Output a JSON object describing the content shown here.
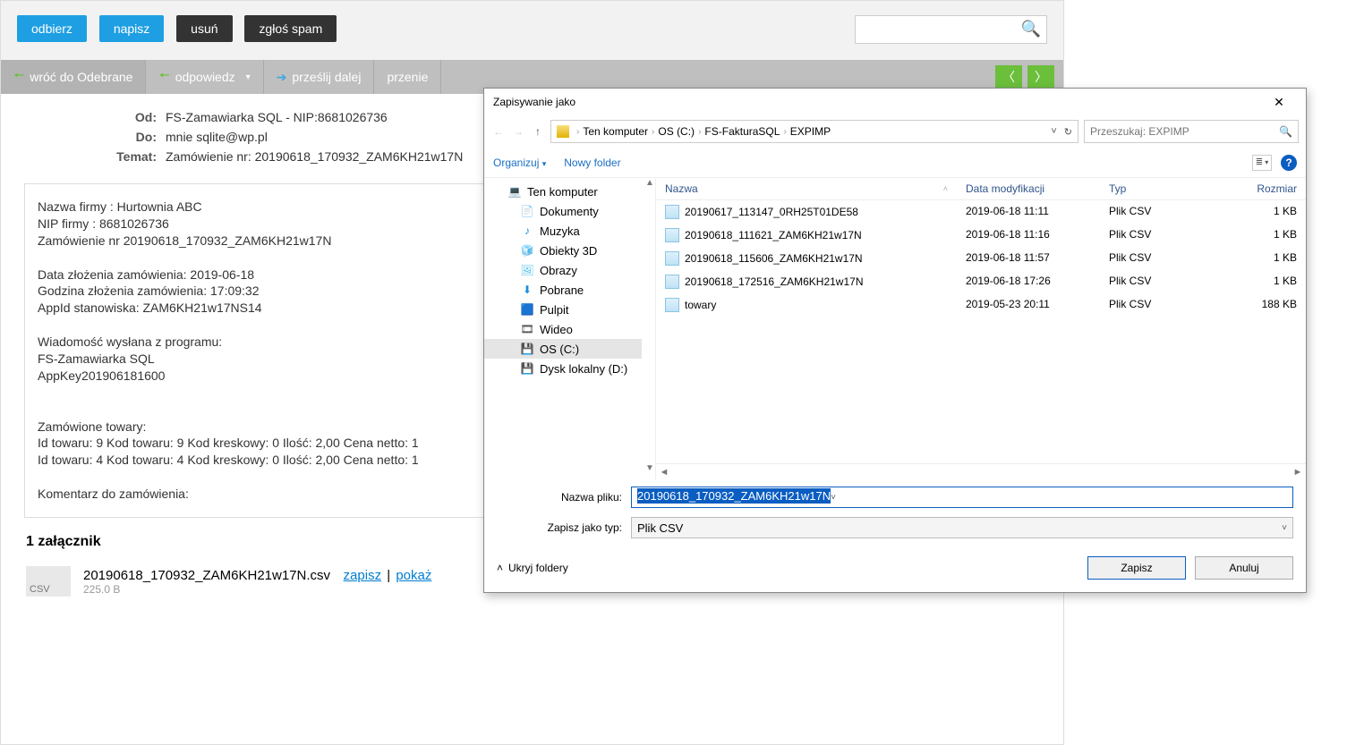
{
  "toolbar": {
    "receive": "odbierz",
    "write": "napisz",
    "delete": "usuń",
    "spam": "zgłoś spam"
  },
  "mail_actions": {
    "back": "wróć do Odebrane",
    "reply": "odpowiedz",
    "forward": "prześlij dalej",
    "move": "przenie"
  },
  "headers": {
    "from_lbl": "Od:",
    "from_val": "FS-Zamawiarka SQL - NIP:8681026736",
    "to_lbl": "Do:",
    "to_val": "mnie  sqlite@wp.pl",
    "subj_lbl": "Temat:",
    "subj_val": "Zamówienie nr: 20190618_170932_ZAM6KH21w17N"
  },
  "body_text": "Nazwa firmy : Hurtownia ABC\nNIP firmy : 8681026736\nZamówienie nr 20190618_170932_ZAM6KH21w17N\n\nData złożenia zamówienia: 2019-06-18\nGodzina złożenia zamówienia: 17:09:32\nAppId stanowiska: ZAM6KH21w17NS14\n\nWiadomość wysłana z programu:\nFS-Zamawiarka SQL\nAppKey201906181600\n\n\nZamówione towary:\nId towaru: 9   Kod towaru: 9   Kod kreskowy: 0   Ilość: 2,00   Cena netto: 1\nId towaru: 4   Kod towaru: 4   Kod kreskowy: 0   Ilość: 2,00   Cena netto: 1\n\nKomentarz do zamówienia:",
  "attach": {
    "count_label": "1 załącznik",
    "badge": "CSV",
    "name": "20190618_170932_ZAM6KH21w17N.csv",
    "save": "zapisz",
    "show": "pokaż",
    "size": "225.0 B"
  },
  "dialog": {
    "title": "Zapisywanie jako",
    "breadcrumb": [
      "Ten komputer",
      "OS (C:)",
      "FS-FakturaSQL",
      "EXPIMP"
    ],
    "search_placeholder": "Przeszukaj: EXPIMP",
    "organize": "Organizuj",
    "new_folder": "Nowy folder",
    "tree": [
      {
        "label": "Ten komputer",
        "icon": "computer",
        "lvl": 1
      },
      {
        "label": "Dokumenty",
        "icon": "document",
        "lvl": 2
      },
      {
        "label": "Muzyka",
        "icon": "music",
        "lvl": 2
      },
      {
        "label": "Obiekty 3D",
        "icon": "object",
        "lvl": 2
      },
      {
        "label": "Obrazy",
        "icon": "image",
        "lvl": 2
      },
      {
        "label": "Pobrane",
        "icon": "download",
        "lvl": 2
      },
      {
        "label": "Pulpit",
        "icon": "desktop",
        "lvl": 2
      },
      {
        "label": "Wideo",
        "icon": "video",
        "lvl": 2
      },
      {
        "label": "OS (C:)",
        "icon": "disk",
        "lvl": 2,
        "selected": true
      },
      {
        "label": "Dysk lokalny (D:)",
        "icon": "disk",
        "lvl": 2
      }
    ],
    "cols": {
      "name": "Nazwa",
      "date": "Data modyfikacji",
      "type": "Typ",
      "size": "Rozmiar"
    },
    "files": [
      {
        "name": "20190617_113147_0RH25T01DE58",
        "date": "2019-06-18 11:11",
        "type": "Plik CSV",
        "size": "1 KB"
      },
      {
        "name": "20190618_111621_ZAM6KH21w17N",
        "date": "2019-06-18 11:16",
        "type": "Plik CSV",
        "size": "1 KB"
      },
      {
        "name": "20190618_115606_ZAM6KH21w17N",
        "date": "2019-06-18 11:57",
        "type": "Plik CSV",
        "size": "1 KB"
      },
      {
        "name": "20190618_172516_ZAM6KH21w17N",
        "date": "2019-06-18 17:26",
        "type": "Plik CSV",
        "size": "1 KB"
      },
      {
        "name": "towary",
        "date": "2019-05-23 20:11",
        "type": "Plik CSV",
        "size": "188 KB"
      }
    ],
    "filename_label": "Nazwa pliku:",
    "filename_value": "20190618_170932_ZAM6KH21w17N",
    "filetype_label": "Zapisz jako typ:",
    "filetype_value": "Plik CSV",
    "hide_folders": "Ukryj foldery",
    "save": "Zapisz",
    "cancel": "Anuluj"
  }
}
